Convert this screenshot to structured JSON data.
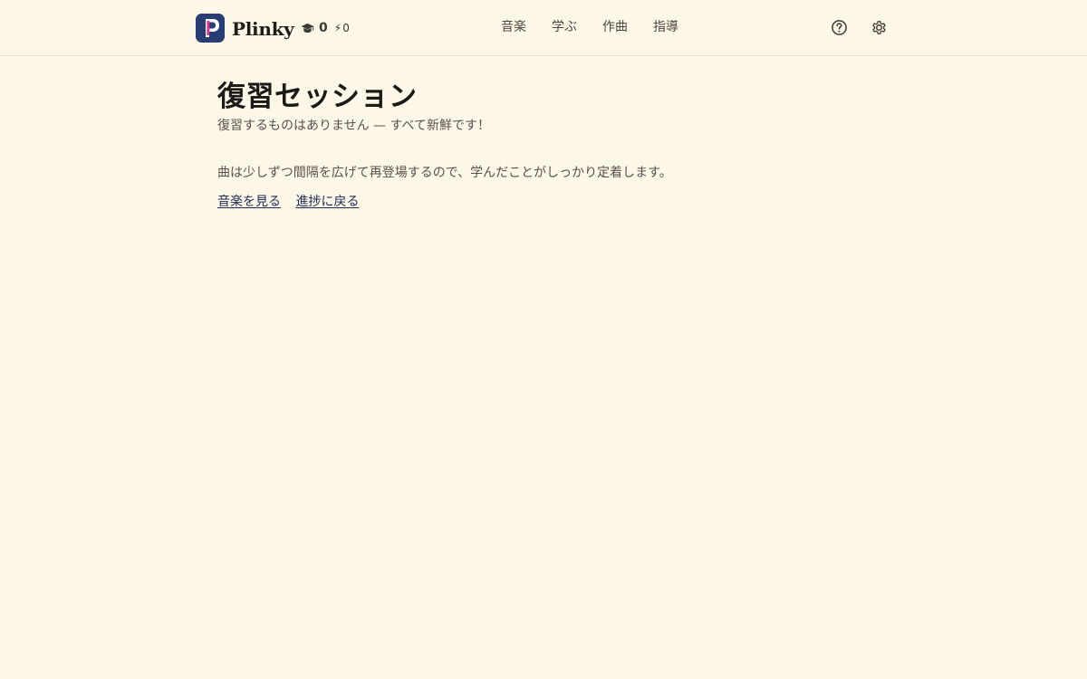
{
  "header": {
    "app_name": "Plinky",
    "logo_letter": "P",
    "brand_color": "#283d76",
    "accent_color": "#e0348c",
    "stats": {
      "education_icon": "graduation-cap-icon",
      "education_count": "0",
      "energy_icon": "lightning-bolt-icon",
      "energy_count": "0"
    },
    "nav": [
      {
        "label": "音楽"
      },
      {
        "label": "学ぶ"
      },
      {
        "label": "作曲"
      },
      {
        "label": "指導"
      }
    ],
    "help_icon": "help-circle-icon",
    "settings_icon": "gear-icon"
  },
  "main": {
    "title": "復習セッション",
    "subtitle": "復習するものはありません — すべて新鮮です！",
    "description": "曲は少しずつ間隔を広げて再登場するので、学んだことがしっかり定着します。",
    "links": [
      {
        "label": "音楽を見る"
      },
      {
        "label": "進捗に戻る"
      }
    ]
  },
  "colors": {
    "background": "#fdf7e8",
    "link": "#1d2a55"
  }
}
